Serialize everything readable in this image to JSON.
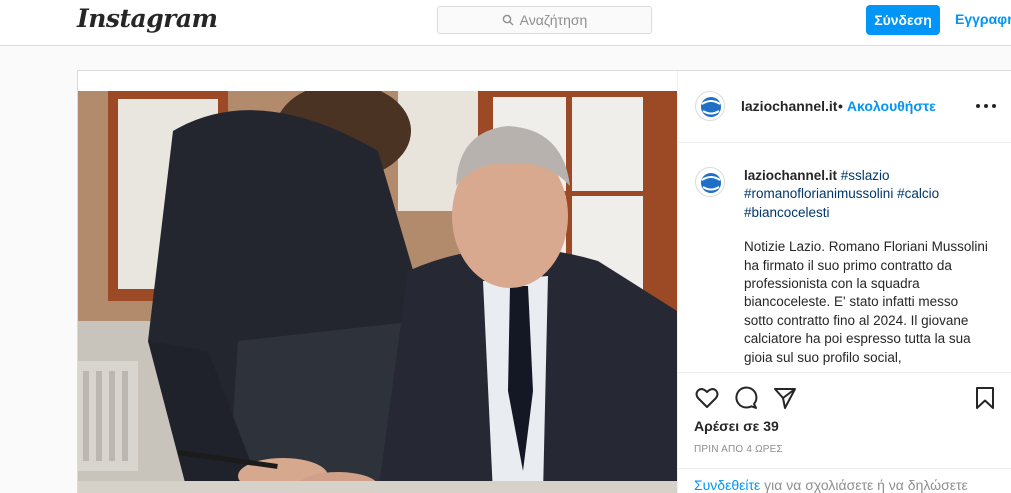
{
  "header": {
    "logo": "Instagram",
    "search_placeholder": "Αναζήτηση",
    "login_label": "Σύνδεση",
    "signup_label": "Εγγραφή"
  },
  "post": {
    "username": "laziochannel.it",
    "follow_dot": "•",
    "follow_label": "Ακολουθήστε",
    "caption": {
      "username": "laziochannel.it",
      "hashtags": [
        "#sslazio",
        "#romanoflorianimussolini",
        "#calcio",
        "#biancocelesti"
      ],
      "text": "Notizie Lazio. Romano Floriani Mussolini ha firmato il suo primo contratto da professionista con la squadra biancoceleste. E' stato infatti messo sotto contratto fino al 2024. Il giovane calciatore ha poi espresso tutta la sua gioia sul suo profilo social,"
    },
    "likes": "Αρέσει σε 39",
    "timestamp": "ΠΡΙΝ ΑΠΟ 4 ΩΡΕΣ",
    "login_prompt": {
      "link": "Συνδεθείτε",
      "text": " για να σχολιάσετε ή να δηλώσετε"
    }
  },
  "colors": {
    "accent": "#0095f6",
    "text": "#262626",
    "muted": "#8e8e8e",
    "hashtag": "#00376b",
    "border": "#dbdbdb"
  }
}
